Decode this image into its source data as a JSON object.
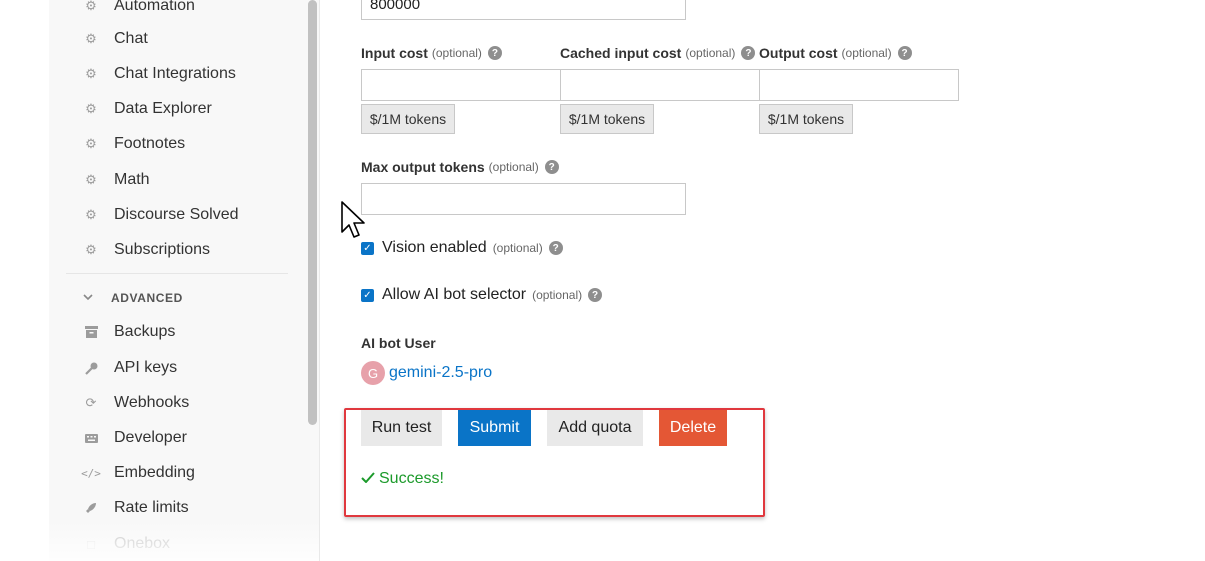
{
  "sidebar": {
    "items": [
      {
        "label": "Automation",
        "icon": "gear-icon"
      },
      {
        "label": "Chat",
        "icon": "gear-icon"
      },
      {
        "label": "Chat Integrations",
        "icon": "gear-icon"
      },
      {
        "label": "Data Explorer",
        "icon": "gear-icon"
      },
      {
        "label": "Footnotes",
        "icon": "gear-icon"
      },
      {
        "label": "Math",
        "icon": "gear-icon"
      },
      {
        "label": "Discourse Solved",
        "icon": "gear-icon"
      },
      {
        "label": "Subscriptions",
        "icon": "gear-icon"
      }
    ],
    "section_title": "ADVANCED",
    "advanced_items": [
      {
        "label": "Backups",
        "icon": "archive-icon"
      },
      {
        "label": "API keys",
        "icon": "key-icon"
      },
      {
        "label": "Webhooks",
        "icon": "sync-icon"
      },
      {
        "label": "Developer",
        "icon": "keyboard-icon"
      },
      {
        "label": "Embedding",
        "icon": "code-icon"
      },
      {
        "label": "Rate limits",
        "icon": "rocket-icon"
      },
      {
        "label": "Onebox",
        "icon": "square-icon"
      }
    ]
  },
  "form": {
    "top_input_value": "800000",
    "optional_text": "(optional)",
    "input_cost_label": "Input cost",
    "cached_input_cost_label": "Cached input cost",
    "output_cost_label": "Output cost",
    "unit_label": "$/1M tokens",
    "input_cost_value": "",
    "cached_input_cost_value": "",
    "output_cost_value": "",
    "max_output_tokens_label": "Max output tokens",
    "max_output_tokens_value": "",
    "vision_enabled_label": "Vision enabled",
    "vision_enabled": true,
    "allow_ai_bot_selector_label": "Allow AI bot selector",
    "allow_ai_bot_selector": true,
    "ai_bot_user_label": "AI bot User",
    "ai_bot_user_avatar": "G",
    "ai_bot_user_name": "gemini-2.5-pro"
  },
  "actions": {
    "run_test": "Run test",
    "submit": "Submit",
    "add_quota": "Add quota",
    "delete": "Delete"
  },
  "status": {
    "message": "Success!"
  },
  "colors": {
    "primary": "#0a74c7",
    "danger": "#e45735",
    "success": "#1c9a2b",
    "highlight": "#e0383e"
  }
}
